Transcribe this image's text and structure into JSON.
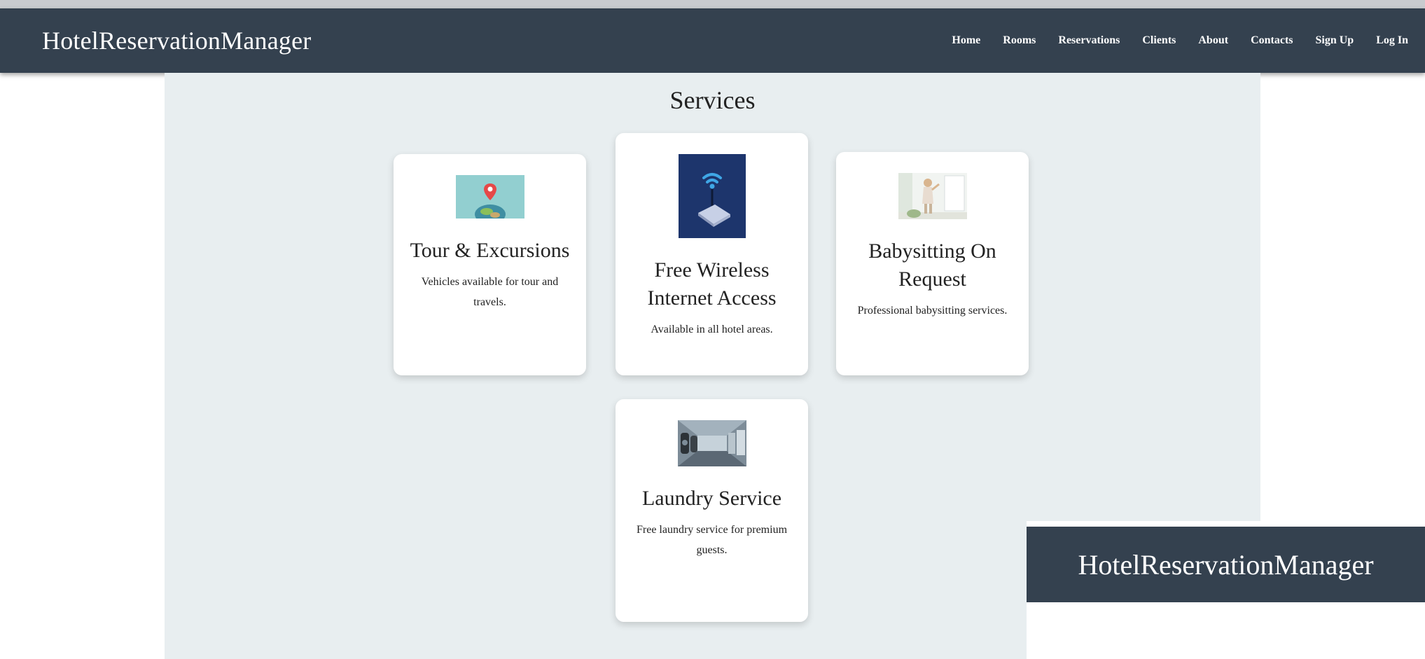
{
  "app": {
    "brand": "HotelReservationManager"
  },
  "nav": {
    "items": [
      {
        "label": "Home"
      },
      {
        "label": "Rooms"
      },
      {
        "label": "Reservations"
      },
      {
        "label": "Clients"
      },
      {
        "label": "About"
      },
      {
        "label": "Contacts"
      },
      {
        "label": "Sign Up"
      },
      {
        "label": "Log In"
      }
    ]
  },
  "services": {
    "title": "Services",
    "cards": [
      {
        "title": "Tour & Excursions",
        "description": "Vehicles available for tour and travels.",
        "icon": "map-pin-globe-image"
      },
      {
        "title": "Free Wireless Internet Access",
        "description": "Available in all hotel areas.",
        "icon": "wifi-router-image"
      },
      {
        "title": "Babysitting On Request",
        "description": "Professional babysitting services.",
        "icon": "child-image"
      },
      {
        "title": "Laundry Service",
        "description": "Free laundry service for premium guests.",
        "icon": "laundry-image"
      }
    ]
  },
  "overlay": {
    "brand": "HotelReservationManager"
  },
  "colors": {
    "navbar": "#34414f",
    "content_bg": "#e8eef0",
    "card_bg": "#ffffff"
  }
}
